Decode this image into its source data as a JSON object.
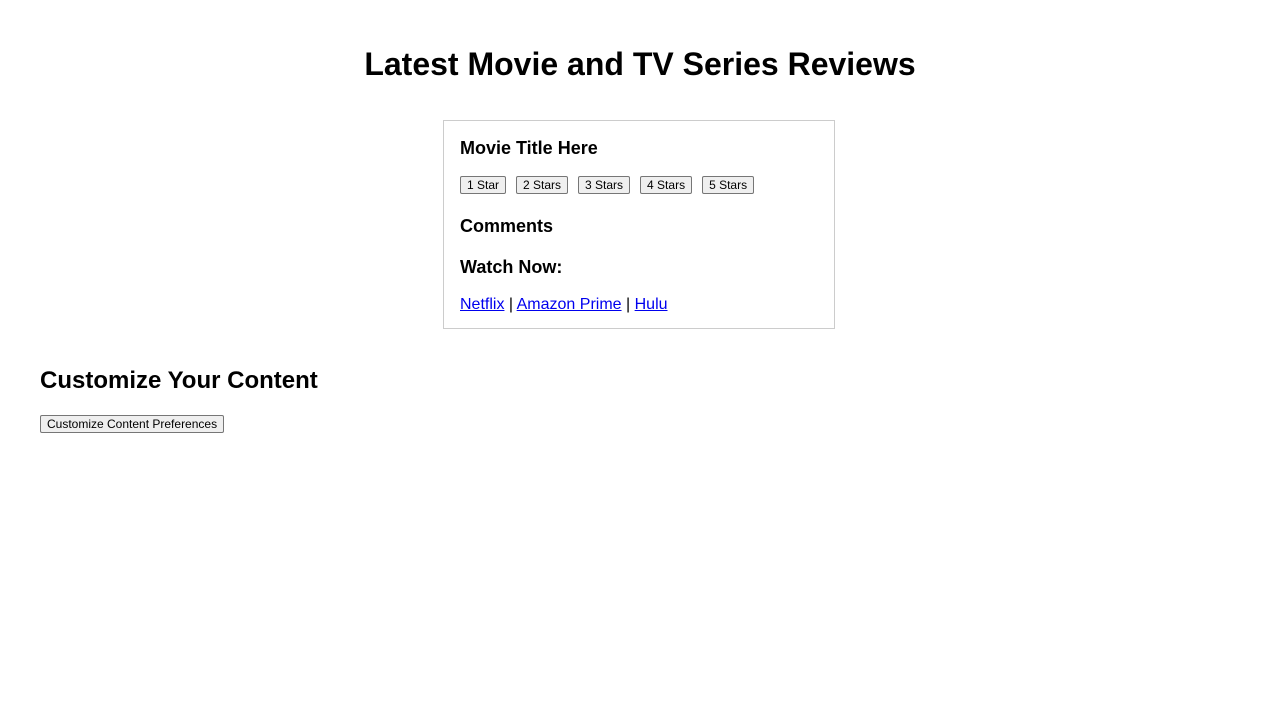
{
  "header": {
    "title": "Latest Movie and TV Series Reviews"
  },
  "review": {
    "movie_title": "Movie Title Here",
    "ratings": [
      "1 Star",
      "2 Stars",
      "3 Stars",
      "4 Stars",
      "5 Stars"
    ],
    "comments_heading": "Comments",
    "watch_heading": "Watch Now:",
    "links": [
      {
        "label": "Netflix"
      },
      {
        "label": "Amazon Prime"
      },
      {
        "label": "Hulu"
      }
    ],
    "separator": "|"
  },
  "customize": {
    "heading": "Customize Your Content",
    "button_label": "Customize Content Preferences"
  },
  "colors": {
    "link": "#0000ee",
    "card_border": "#cccccc",
    "text": "#000000"
  }
}
